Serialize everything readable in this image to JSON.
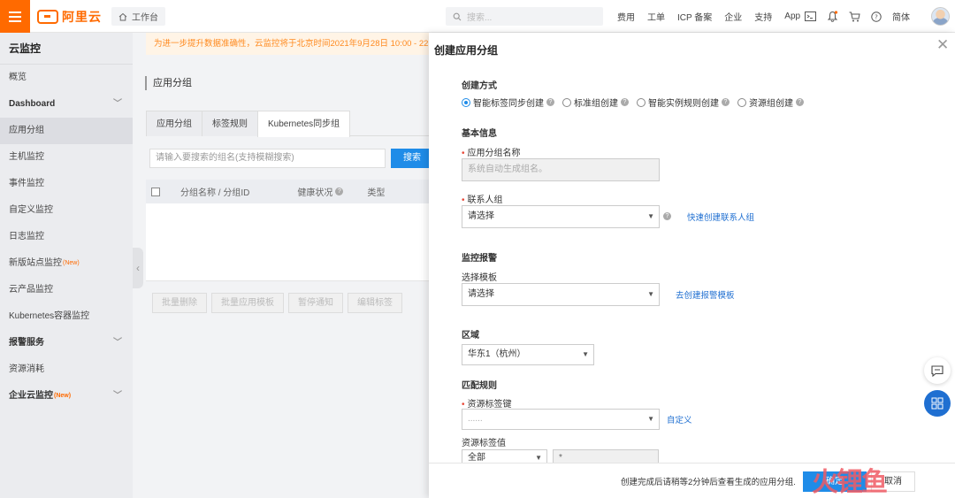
{
  "topbar": {
    "brand": "阿里云",
    "workbench": "工作台",
    "search_placeholder": "搜索...",
    "links": [
      "费用",
      "工单",
      "ICP 备案",
      "企业",
      "支持",
      "App"
    ],
    "lang": "简体",
    "icons": [
      "menu-icon",
      "home-icon",
      "search-icon",
      "terminal-icon",
      "bell-icon",
      "cart-icon",
      "help-icon"
    ]
  },
  "sidebar": {
    "title": "云监控",
    "items": [
      {
        "label": "概览",
        "bold": false
      },
      {
        "label": "Dashboard",
        "bold": true,
        "chevron": true
      },
      {
        "label": "应用分组",
        "active": true
      },
      {
        "label": "主机监控"
      },
      {
        "label": "事件监控"
      },
      {
        "label": "自定义监控"
      },
      {
        "label": "日志监控"
      },
      {
        "label": "新版站点监控",
        "tag": "New"
      },
      {
        "label": "云产品监控"
      },
      {
        "label": "Kubernetes容器监控"
      },
      {
        "label": "报警服务",
        "bold": true,
        "chevron": true
      },
      {
        "label": "资源消耗"
      },
      {
        "label": "企业云监控",
        "bold": true,
        "tag": "New",
        "chevron": true
      }
    ]
  },
  "main": {
    "notice": "为进一步提升数据准确性，云监控将于北京时间2021年9月28日 10:00 - 22:00",
    "title": "应用分组",
    "tabs": [
      "应用分组",
      "标签规则",
      "Kubernetes同步组"
    ],
    "search_placeholder": "请输入要搜索的组名(支持模糊搜索)",
    "search_btn": "搜索",
    "columns": [
      "分组名称 / 分组ID",
      "健康状况",
      "类型"
    ],
    "bulk_actions": [
      "批量删除",
      "批量应用模板",
      "暂停通知",
      "编辑标签"
    ]
  },
  "drawer": {
    "title": "创建应用分组",
    "create_mode_label": "创建方式",
    "create_modes": [
      "智能标签同步创建",
      "标准组创建",
      "智能实例规则创建",
      "资源组创建"
    ],
    "basic_info": "基本信息",
    "group_name_label": "应用分组名称",
    "group_name_placeholder": "系统自动生成组名。",
    "contact_label": "联系人组",
    "contact_value": "请选择",
    "contact_link": "快速创建联系人组",
    "alarm_section": "监控报警",
    "template_label": "选择模板",
    "template_value": "请选择",
    "template_link": "去创建报警模板",
    "region_label": "区域",
    "region_value": "华东1（杭州）",
    "match_rule": "匹配规则",
    "tag_key_label": "资源标签键",
    "tag_key_value": "......",
    "tag_key_link": "自定义",
    "tag_value_label": "资源标签值",
    "tag_value_op": "全部",
    "tag_value_input": "*",
    "footer_note": "创建完成后请稍等2分钟后查看生成的应用分组.",
    "ok_btn": "确定",
    "cancel_btn": "取消"
  },
  "watermark": "火锂鱼",
  "colors": {
    "brand": "#ff6a00",
    "primary": "#1f8ce8",
    "link": "#1f6fd1",
    "required": "#e84a3a"
  }
}
